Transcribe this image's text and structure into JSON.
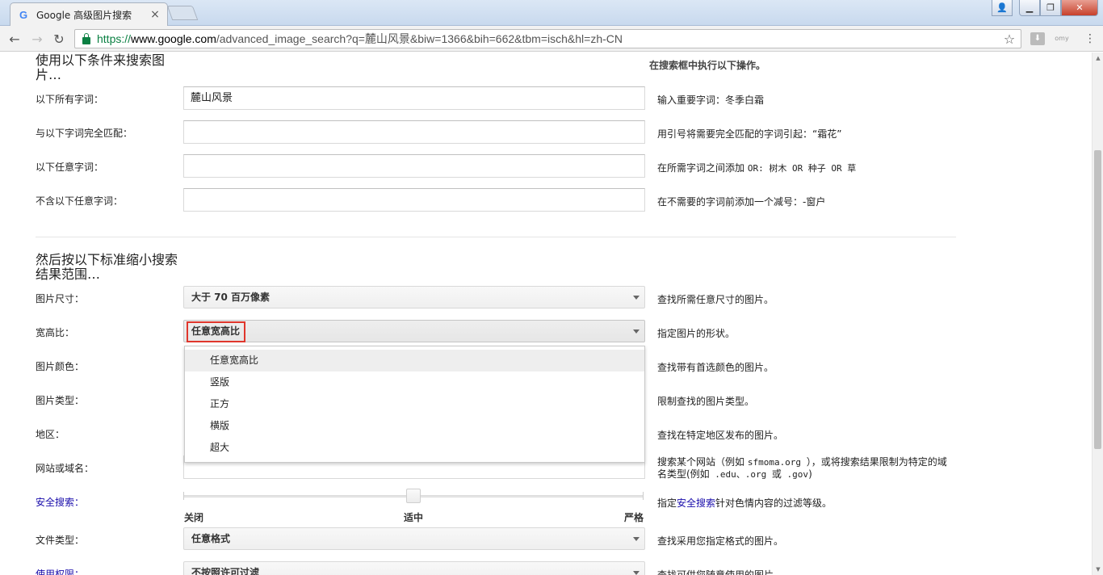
{
  "browser": {
    "tab_title": "Google 高级图片搜索",
    "tab_close": "×",
    "favicon": "G",
    "url_scheme": "https://",
    "url_host": "www.google.com",
    "url_path": "/advanced_image_search?q=麓山风景&biw=1366&bih=662&tbm=isch&hl=zh-CN",
    "ext2_label": "omy"
  },
  "section1": {
    "title": "使用以下条件来搜索图片…",
    "side_heading": "在搜索框中执行以下操作。",
    "rows": [
      {
        "label": "以下所有字词：",
        "value": "麓山风景",
        "hint": "输入重要字词：冬季白霜"
      },
      {
        "label": "与以下字词完全匹配：",
        "value": "",
        "hint": "用引号将需要完全匹配的字词引起：“霜花”"
      },
      {
        "label": "以下任意字词：",
        "value": "",
        "hint_pre": "在所需字词之间添加 ",
        "hint_mono": "OR: 树木 OR 种子 OR 草"
      },
      {
        "label": "不含以下任意字词：",
        "value": "",
        "hint": "在不需要的字词前添加一个减号：-窗户"
      }
    ]
  },
  "section2": {
    "title": "然后按以下标准缩小搜索结果范围…",
    "size": {
      "label": "图片尺寸：",
      "value": "大于 70 百万像素",
      "hint": "查找所需任意尺寸的图片。"
    },
    "aspect": {
      "label": "宽高比：",
      "value": "任意宽高比",
      "hint": "指定图片的形状。",
      "options": [
        "任意宽高比",
        "竖版",
        "正方",
        "横版",
        "超大"
      ]
    },
    "color": {
      "label": "图片颜色：",
      "hint": "查找带有首选颜色的图片。"
    },
    "type": {
      "label": "图片类型：",
      "hint": "限制查找的图片类型。"
    },
    "region": {
      "label": "地区：",
      "hint": "查找在特定地区发布的图片。"
    },
    "site": {
      "label": "网站或域名：",
      "hint_line1_pre": "搜索某个网站（例如 ",
      "hint_line1_mono": " sfmoma.org ",
      "hint_line1_post": "），或将搜索结果限制为特定的域",
      "hint_line2_pre": "名类型(例如",
      "hint_line2_mono": " .edu、.org ",
      "hint_line2_mid": "或",
      "hint_line2_mono2": " .gov",
      "hint_line2_post": ")"
    },
    "safe": {
      "label": "安全搜索：",
      "hint_pre": "指定",
      "hint_link": "安全搜索",
      "hint_post": "针对色情内容的过滤等级。",
      "levels": [
        "关闭",
        "适中",
        "严格"
      ],
      "current_level": "适中"
    },
    "filetype": {
      "label": "文件类型：",
      "value": "任意格式",
      "hint": "查找采用您指定格式的图片。"
    },
    "rights": {
      "label": "使用权限：",
      "value": "不按照许可过滤",
      "hint": "查找可供您随意使用的图片。"
    }
  }
}
